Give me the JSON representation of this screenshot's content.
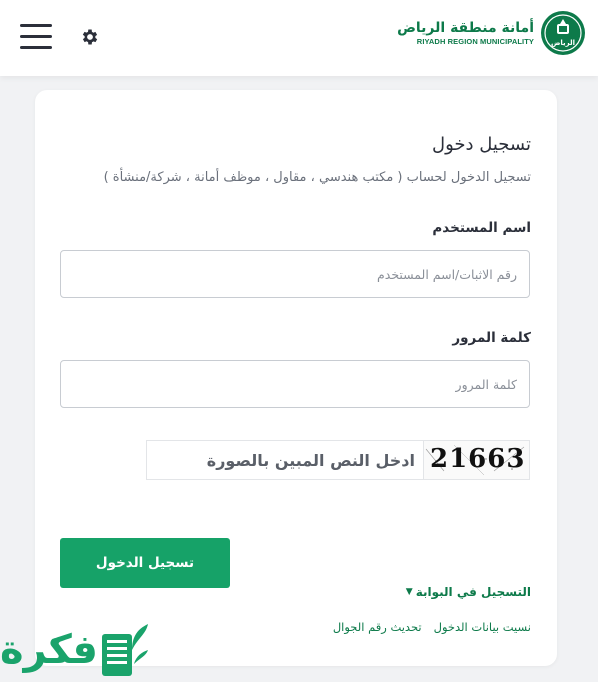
{
  "header": {
    "logo_arabic": "أمانة منطقة الرياض",
    "logo_english": "RIYADH REGION MUNICIPALITY",
    "logo_emblem_text": "الرياض",
    "menu_icon": "hamburger-menu-icon",
    "settings_icon": "gear-icon"
  },
  "login": {
    "title": "تسجيل دخول",
    "subtitle": "تسجيل الدخول لحساب ( مكتب هندسي ، مقاول ، موظف أمانة ، شركة/منشأة )",
    "username": {
      "label": "اسم المستخدم",
      "placeholder": "رقم الاثبات/اسم المستخدم",
      "value": ""
    },
    "password": {
      "label": "كلمة المرور",
      "placeholder": "كلمة المرور",
      "value": ""
    },
    "captcha": {
      "placeholder": "ادخل النص المبين بالصورة",
      "image_text": "21663"
    },
    "submit_label": "تسجيل الدخول",
    "portal_register_label": "التسجيل في البوابة",
    "forgot_label": "نسيت بيانات الدخول",
    "update_mobile_label": "تحديث رقم الجوال"
  },
  "watermark": {
    "text": "فكرة"
  },
  "colors": {
    "brand_green": "#0d7a4a",
    "button_green": "#16a268",
    "page_bg": "#f1f2f4"
  }
}
